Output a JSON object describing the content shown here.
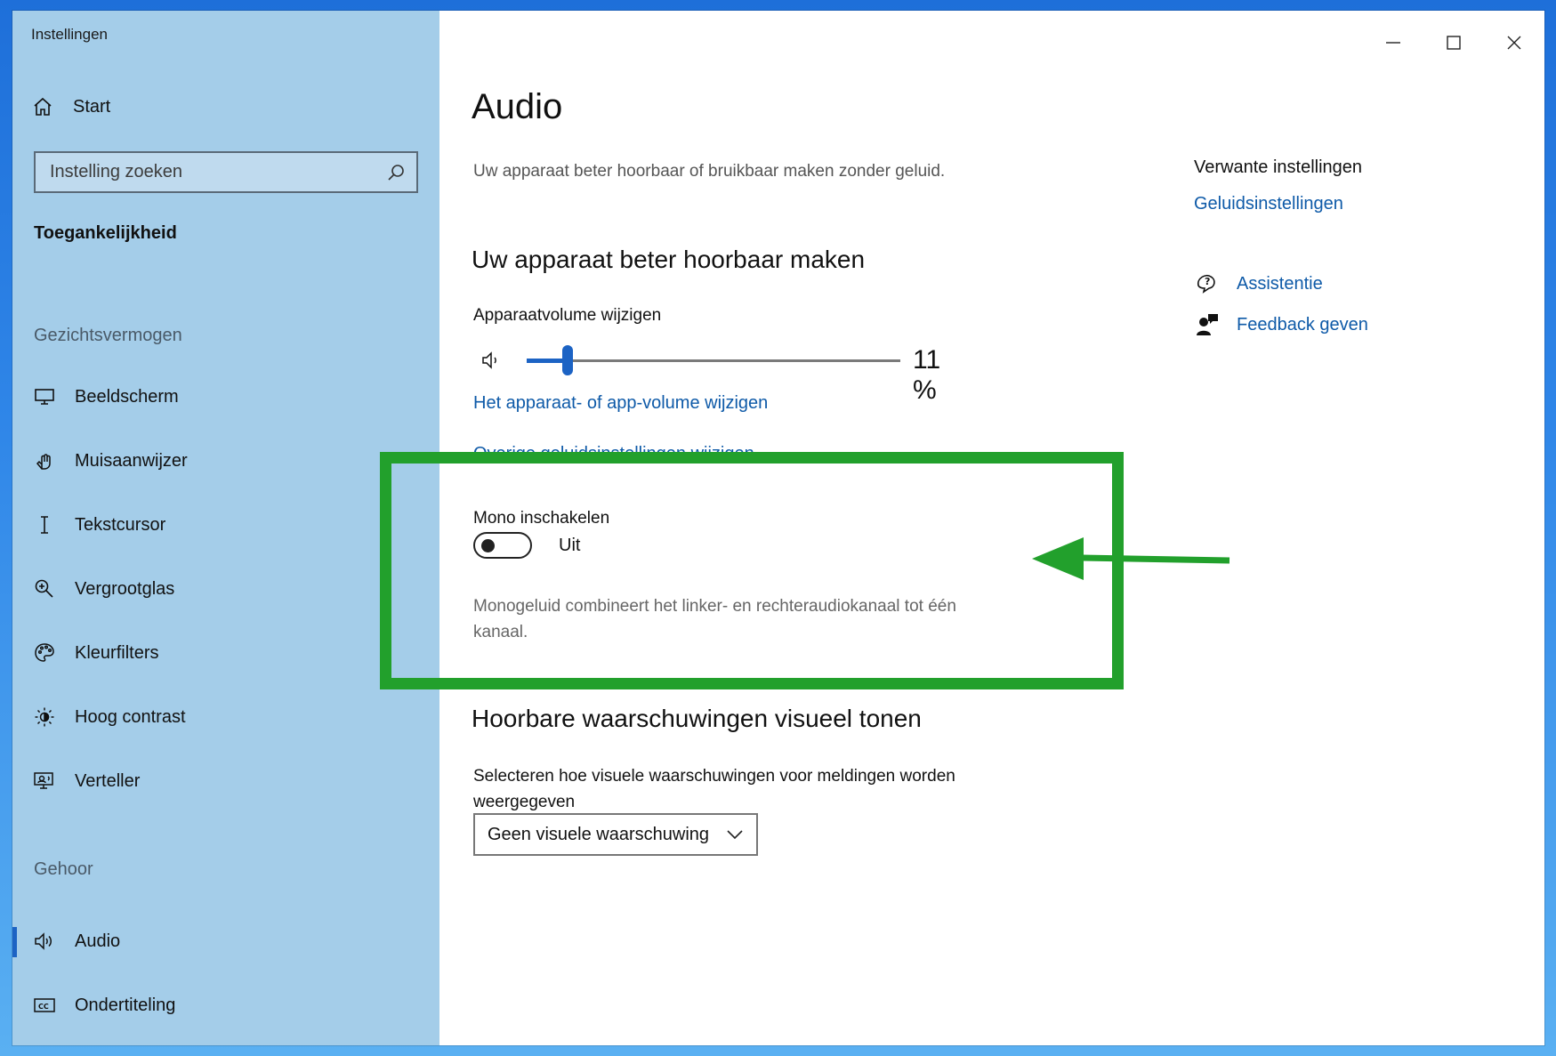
{
  "window": {
    "title": "Instellingen",
    "controls": {
      "minimize": "—",
      "maximize": "☐",
      "close": "✕"
    }
  },
  "sidebar": {
    "home_label": "Start",
    "search": {
      "placeholder": "Instelling zoeken"
    },
    "category": "Toegankelijkheid",
    "groups": [
      {
        "label": "Gezichtsvermogen",
        "items": [
          {
            "label": "Beeldscherm",
            "icon": "monitor-icon"
          },
          {
            "label": "Muisaanwijzer",
            "icon": "pointer-icon"
          },
          {
            "label": "Tekstcursor",
            "icon": "text-cursor-icon"
          },
          {
            "label": "Vergrootglas",
            "icon": "magnifier-icon"
          },
          {
            "label": "Kleurfilters",
            "icon": "palette-icon"
          },
          {
            "label": "Hoog contrast",
            "icon": "brightness-icon"
          },
          {
            "label": "Verteller",
            "icon": "narrator-icon"
          }
        ]
      },
      {
        "label": "Gehoor",
        "items": [
          {
            "label": "Audio",
            "icon": "speaker-icon",
            "active": true
          },
          {
            "label": "Ondertiteling",
            "icon": "captions-icon"
          }
        ]
      }
    ]
  },
  "main": {
    "title": "Audio",
    "subtitle": "Uw apparaat beter hoorbaar of bruikbaar maken zonder geluid.",
    "section1": {
      "heading": "Uw apparaat beter hoorbaar maken",
      "volume_label": "Apparaatvolume wijzigen",
      "volume_value": 11,
      "volume_text": "11 %",
      "link_volume": "Het apparaat- of app-volume wijzigen",
      "link_hidden": "Overige geluidsinstellingen wijzigen",
      "mono_label": "Mono inschakelen",
      "mono_state": "Uit",
      "mono_on": false,
      "mono_desc_line1": "Monogeluid combineert het linker- en rechteraudiokanaal tot één",
      "mono_desc_line2": "kanaal."
    },
    "section2": {
      "heading": "Hoorbare waarschuwingen visueel tonen",
      "label_line1": "Selecteren hoe visuele waarschuwingen voor meldingen worden",
      "label_line2": "weergegeven",
      "dropdown_value": "Geen visuele waarschuwing"
    }
  },
  "related": {
    "title": "Verwante instellingen",
    "link": "Geluidsinstellingen",
    "help": [
      {
        "label": "Assistentie",
        "icon": "help-chat-icon"
      },
      {
        "label": "Feedback geven",
        "icon": "feedback-icon"
      }
    ]
  },
  "colors": {
    "sidebar_bg": "#a4cde9",
    "accent": "#1c63c4",
    "link": "#0e5aa8",
    "highlight": "#22a02c"
  }
}
